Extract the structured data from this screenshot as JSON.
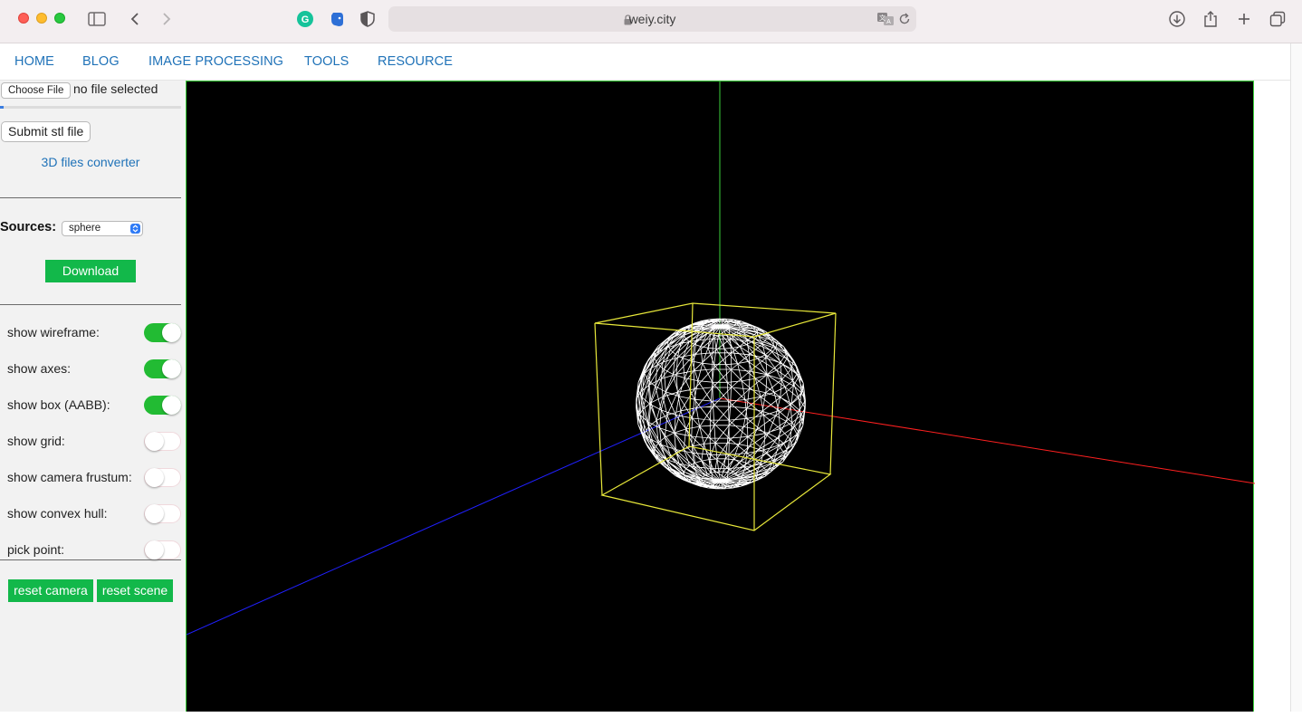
{
  "browser": {
    "url": "weiy.city",
    "icons": [
      "sidebar-icon",
      "back-icon",
      "forward-icon",
      "grammarly-icon",
      "evernote-icon",
      "shield-icon",
      "lock-icon",
      "translate-icon",
      "reload-icon",
      "download-icon",
      "share-icon",
      "new-tab-icon",
      "tabs-icon"
    ]
  },
  "nav": {
    "items": [
      "HOME",
      "BLOG",
      "IMAGE PROCESSING",
      "TOOLS",
      "RESOURCE"
    ]
  },
  "sidebar": {
    "file_button": "Choose File",
    "file_status": "no file selected",
    "upload_progress": 0.02,
    "submit_label": "Submit stl file",
    "converter_link": "3D files converter",
    "sources_label": "Sources:",
    "source_selected": "sphere",
    "download_label": "Download",
    "toggles": [
      {
        "label": "show wireframe:",
        "on": true
      },
      {
        "label": "show axes:",
        "on": true
      },
      {
        "label": "show box (AABB):",
        "on": true
      },
      {
        "label": "show grid:",
        "on": false
      },
      {
        "label": "show camera frustum:",
        "on": false
      },
      {
        "label": "show convex hull:",
        "on": false
      },
      {
        "label": "pick point:",
        "on": false
      }
    ],
    "reset_camera_label": "reset camera",
    "reset_scene_label": "reset scene"
  },
  "colors": {
    "accent_green": "#12b84a",
    "toggle_on": "#22bb33",
    "link_blue": "#1f72b8",
    "axis_x": "#ff2020",
    "axis_y": "#3bd13b",
    "axis_z": "#2020ff",
    "aabb_box": "#e8e83a",
    "wireframe": "#ffffff"
  }
}
